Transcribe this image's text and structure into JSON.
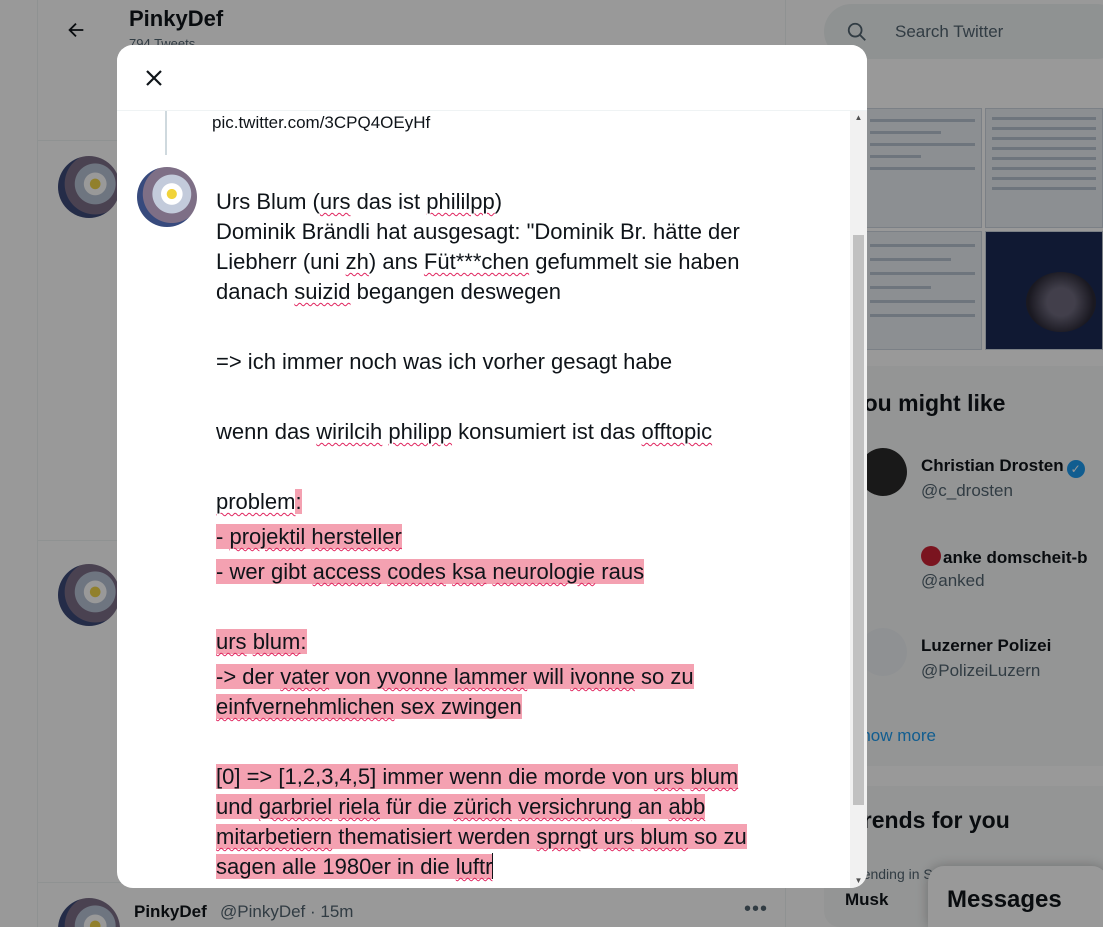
{
  "background": {
    "profile_name": "PinkyDef",
    "tweet_count": "794 Tweets",
    "tweet_author": "PinkyDef",
    "tweet_meta": "@PinkyDef · 15m"
  },
  "sidebar": {
    "search_placeholder": "Search Twitter",
    "who_to_follow_title": "You might like",
    "suggestions": [
      {
        "name": "Christian Drosten",
        "handle": "@c_drosten"
      },
      {
        "name": "anke domscheit-b",
        "handle": "@anked"
      },
      {
        "name": "Luzerner Polizei",
        "handle": "@PolizeiLuzern"
      }
    ],
    "show_more": "Show more",
    "trends_title": "Trends for you",
    "trend_context": "Trending in S",
    "trend_name": "Musk",
    "messages_label": "Messages"
  },
  "modal": {
    "link": "pic.twitter.com/3CPQ4OEyHf",
    "lines": {
      "l1a": "Urs Blum (",
      "l1b": "urs",
      "l1c": " das ist ",
      "l1d": "phililpp",
      "l1e": ")",
      "l2a": "Dominik Brändli hat ausgesagt: \"Dominik Br. hätte der",
      "l3a": "Liebherr (uni ",
      "l3b": "zh",
      "l3c": ") ans ",
      "l3d": "Füt***chen",
      "l3e": " gefummelt sie haben",
      "l4a": "danach ",
      "l4b": "suizid",
      "l4c": " begangen deswegen",
      "l5a": "=> ich immer noch was ich vorher gesagt habe",
      "l6a": "wenn das ",
      "l6b": "wirilcih",
      "l6c": " ",
      "l6d": "philipp",
      "l6e": " konsumiert ist das ",
      "l6f": "offtopic",
      "l7a": "problem",
      "l7b": ":",
      "l8a": "- ",
      "l8b": "projektil",
      "l8c": " ",
      "l8d": "hersteller",
      "l9a": "- wer gibt ",
      "l9b": "access",
      "l9c": " ",
      "l9d": "codes",
      "l9e": " ",
      "l9f": "ksa",
      "l9g": " ",
      "l9h": "neurologie",
      "l9i": " raus",
      "l10a": "urs",
      "l10b": " ",
      "l10c": "blum",
      "l10d": ":",
      "l11a": "-> der ",
      "l11b": "vater",
      "l11c": " von ",
      "l11d": "yvonne",
      "l11e": " ",
      "l11f": "lammer",
      "l11g": " will ",
      "l11h": "ivonne",
      "l11i": " so zu",
      "l12a": "einfvernehmlichen",
      "l12b": " sex zwingen",
      "l13a": "[0] => [1,2,3,4,5] immer wenn die morde von ",
      "l13b": "urs",
      "l13c": " ",
      "l13d": "blum",
      "l14a": "und ",
      "l14b": "garbriel",
      "l14c": " ",
      "l14d": "riela",
      "l14e": " für die ",
      "l14f": "zürich",
      "l14g": " ",
      "l14h": "versichrung",
      "l14i": " an ",
      "l14j": "abb",
      "l15a": "mitarbetiern",
      "l15b": " thematisiert werden ",
      "l15c": "sprngt",
      "l15d": " ",
      "l15e": "urs",
      "l15f": " ",
      "l15g": "blum",
      "l15h": " so zu",
      "l16a": "sagen alle 1980er in die ",
      "l16b": "luftr"
    }
  },
  "colors": {
    "highlight": "#f4a1b1",
    "accent": "#1d9bf0",
    "spellcheck": "#e0245e"
  },
  "icons": [
    "back-arrow-icon",
    "close-icon",
    "search-icon",
    "verified-icon",
    "more-icon"
  ]
}
